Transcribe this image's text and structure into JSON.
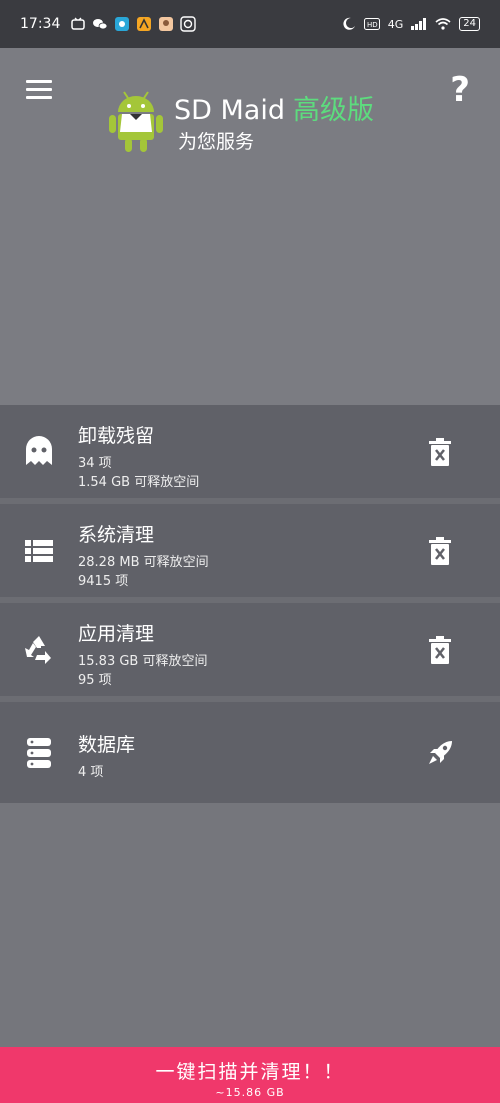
{
  "status_bar": {
    "time": "17:34",
    "network": "4G",
    "battery": "24"
  },
  "header": {
    "app_name": "SD Maid",
    "edition": "高级版",
    "subtitle": "为您服务",
    "help": "?"
  },
  "items": [
    {
      "title": "卸载残留",
      "line1": "34 项",
      "line2": "1.54 GB 可释放空间",
      "icon": "ghost-icon",
      "action": "delete-icon"
    },
    {
      "title": "系统清理",
      "line1": "28.28 MB 可释放空间",
      "line2": "9415 项",
      "icon": "list-icon",
      "action": "delete-icon"
    },
    {
      "title": "应用清理",
      "line1": "15.83 GB 可释放空间",
      "line2": "95 项",
      "icon": "recycle-icon",
      "action": "delete-icon"
    },
    {
      "title": "数据库",
      "line1": "4 项",
      "icon": "database-icon",
      "action": "rocket-icon"
    }
  ],
  "scan": {
    "label": "一键扫描并清理！！",
    "size": "~15.86 GB"
  },
  "colors": {
    "background": "#75767c",
    "status_bar": "#3a3b40",
    "card": "#606168",
    "accent_green": "#5ddc7e",
    "scan_bar": "#f0386b"
  }
}
